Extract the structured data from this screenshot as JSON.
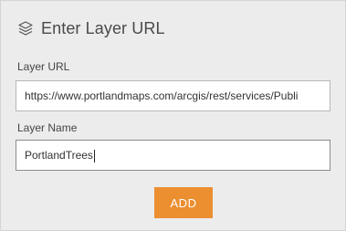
{
  "header": {
    "icon": "layers-icon",
    "title": "Enter Layer URL"
  },
  "form": {
    "url_label": "Layer URL",
    "url_value": "https://www.portlandmaps.com/arcgis/rest/services/Publi",
    "name_label": "Layer Name",
    "name_value": "PortlandTrees",
    "add_label": "ADD"
  },
  "colors": {
    "background": "#ececec",
    "accent": "#eb8f31",
    "input_background": "#ffffff"
  }
}
